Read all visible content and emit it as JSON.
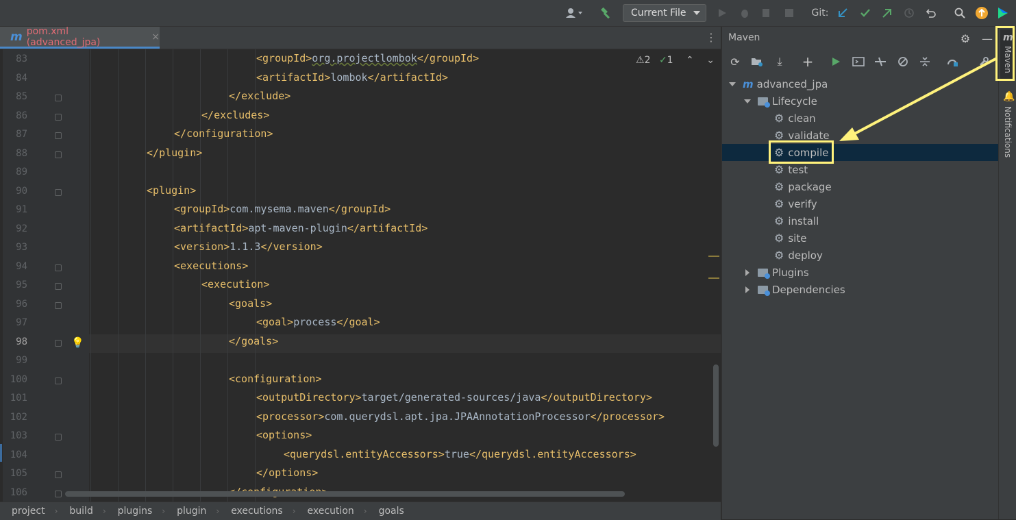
{
  "toolbar": {
    "run_config": "Current File",
    "git_label": "Git:"
  },
  "tab": {
    "label": "pom.xml (advanced_jpa)",
    "close": "×"
  },
  "inspections": {
    "warnings": "2",
    "weak_warnings": "1"
  },
  "editor": {
    "line_numbers": [
      "83",
      "84",
      "85",
      "86",
      "87",
      "88",
      "89",
      "90",
      "91",
      "92",
      "93",
      "94",
      "95",
      "96",
      "97",
      "98",
      "99",
      "100",
      "101",
      "102",
      "103",
      "104",
      "105",
      "106"
    ],
    "current_line": "98",
    "lines": [
      {
        "indent": 6,
        "open": "groupId",
        "text": "org.projectlombok",
        "close": "groupId"
      },
      {
        "indent": 6,
        "open": "artifactId",
        "text": "lombok",
        "close": "artifactId"
      },
      {
        "indent": 5,
        "close_only": "exclude"
      },
      {
        "indent": 4,
        "close_only": "excludes"
      },
      {
        "indent": 3,
        "close_only": "configuration"
      },
      {
        "indent": 2,
        "close_only": "plugin"
      },
      {
        "indent": 0,
        "empty": true
      },
      {
        "indent": 2,
        "open_only": "plugin"
      },
      {
        "indent": 3,
        "open": "groupId",
        "text": "com.mysema.maven",
        "close": "groupId"
      },
      {
        "indent": 3,
        "open": "artifactId",
        "text": "apt-maven-plugin",
        "close": "artifactId"
      },
      {
        "indent": 3,
        "open": "version",
        "text": "1.1.3",
        "close": "version"
      },
      {
        "indent": 3,
        "open_only": "executions"
      },
      {
        "indent": 4,
        "open_only": "execution"
      },
      {
        "indent": 5,
        "open_only": "goals"
      },
      {
        "indent": 6,
        "open": "goal",
        "text": "process",
        "close": "goal"
      },
      {
        "indent": 5,
        "close_only": "goals"
      },
      {
        "indent": 0,
        "empty": true
      },
      {
        "indent": 5,
        "open_only": "configuration"
      },
      {
        "indent": 6,
        "open": "outputDirectory",
        "text": "target/generated-sources/java",
        "close": "outputDirectory"
      },
      {
        "indent": 6,
        "open": "processor",
        "text": "com.querydsl.apt.jpa.JPAAnnotationProcessor",
        "close": "processor"
      },
      {
        "indent": 6,
        "open_only": "options"
      },
      {
        "indent": 7,
        "open": "querydsl.entityAccessors",
        "text": "true",
        "close": "querydsl.entityAccessors"
      },
      {
        "indent": 6,
        "close_only": "options"
      },
      {
        "indent": 5,
        "close_only": "configuration"
      }
    ]
  },
  "breadcrumb": [
    "project",
    "build",
    "plugins",
    "plugin",
    "executions",
    "execution",
    "goals"
  ],
  "maven": {
    "title": "Maven",
    "project": "advanced_jpa",
    "lifecycle_label": "Lifecycle",
    "phases": [
      "clean",
      "validate",
      "compile",
      "test",
      "package",
      "verify",
      "install",
      "site",
      "deploy"
    ],
    "selected_phase": "compile",
    "plugins_label": "Plugins",
    "dependencies_label": "Dependencies"
  },
  "right_strip": {
    "maven_tab": "Maven",
    "notifications_tab": "Notifications"
  },
  "colors": {
    "highlight": "#fff27c",
    "tag": "#e8bf6a",
    "text": "#a9b7c6",
    "selection": "#0d293e"
  }
}
